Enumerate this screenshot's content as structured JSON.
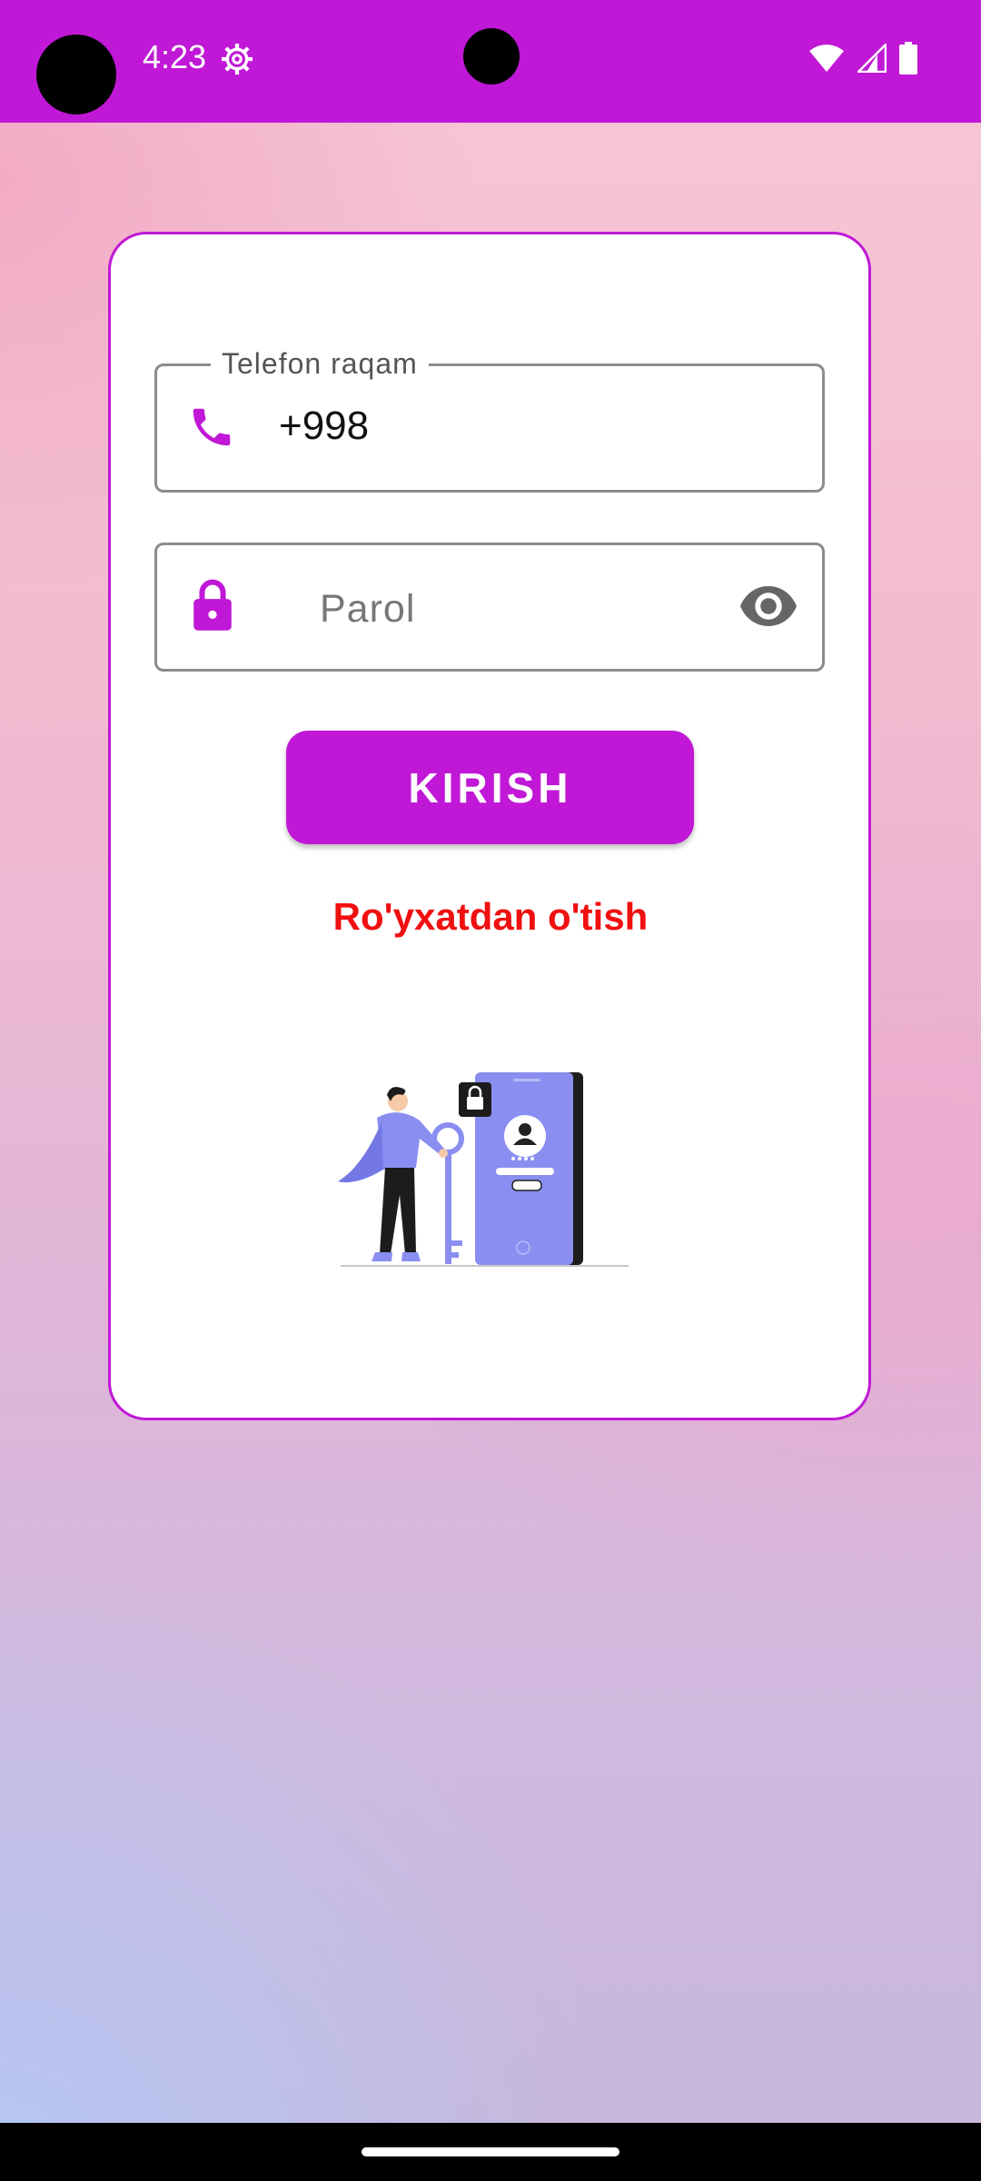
{
  "status_bar": {
    "time": "4:23",
    "icons": [
      "settings-gear-icon",
      "wifi-icon",
      "cellular-signal-icon",
      "battery-icon"
    ],
    "background_color": "#c018d6"
  },
  "form": {
    "phone_field": {
      "label": "Telefon raqam",
      "value": "+998",
      "icon": "phone-icon"
    },
    "password_field": {
      "placeholder": "Parol",
      "icon": "lock-icon",
      "toggle_icon": "eye-icon"
    },
    "login_button_label": "KIRISH",
    "register_link": "Ro'yxatdan o'tish",
    "illustration": "login-key-phone-illustration",
    "accent_color": "#c018d6",
    "link_color": "#f01010"
  }
}
